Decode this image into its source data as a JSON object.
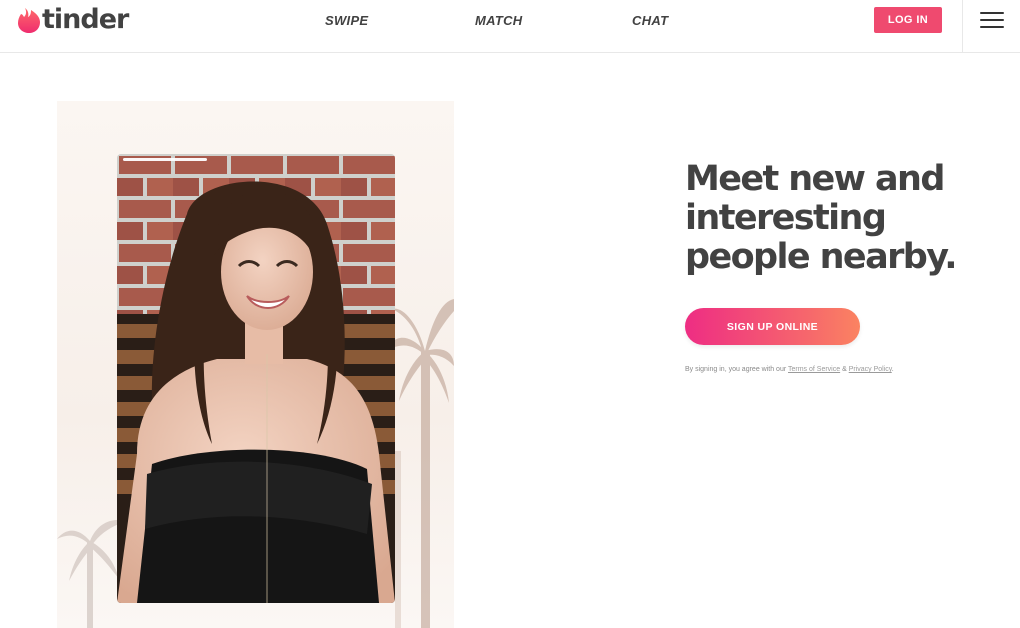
{
  "brand": {
    "name": "tinder",
    "color": "#ef4a6f"
  },
  "nav": {
    "swipe": "SWIPE",
    "match": "MATCH",
    "chat": "CHAT"
  },
  "header": {
    "login_label": "LOG IN",
    "menu_icon": "hamburger-menu-icon"
  },
  "hero": {
    "headline": "Meet new and interesting people nearby.",
    "signup_label": "SIGN UP ONLINE",
    "legal_prefix": "By signing in, you agree with our ",
    "terms_label": "Terms of Service",
    "legal_and": " & ",
    "privacy_label": "Privacy Policy",
    "legal_suffix": "."
  },
  "colors": {
    "text": "#424242",
    "gradient_start": "#ee2d83",
    "gradient_end": "#fb8361"
  }
}
